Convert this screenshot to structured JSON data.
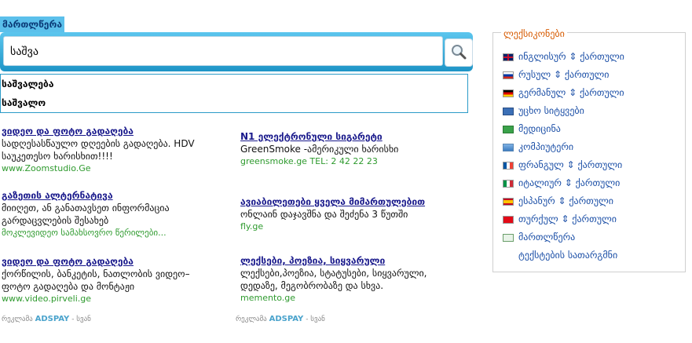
{
  "tab_label": "მართლწერა",
  "search": {
    "value": "საშვა"
  },
  "suggestions": [
    "საშვალება",
    "საშვალო"
  ],
  "ads_left": [
    {
      "title": "ვიდეო და ფოტო გადაღება",
      "desc1": "სადღესასწაულო დღეების გადაღება. HDV",
      "desc2": "საუკეთესო ხარისხით!!!!",
      "url": "www.Zoomstudio.Ge"
    },
    {
      "title": "გაზეთის ალტერნატივა",
      "desc1": "მიიღეთ, ან განათავსეთ ინფორმაცია",
      "desc2": "გარდაცვლების შესახებ",
      "url": "მოკლევიდეო სამახსოვრო წერილები..."
    },
    {
      "title": "ვიდეო და ფოტო გადაღება",
      "desc1": "ქორწილის, ბანკეტის, ნათლობის ვიდეო–",
      "desc2": "ფოტო გადაღება და მონტაჟი",
      "url": "www.video.pirveli.ge"
    }
  ],
  "ads_right": [
    {
      "title": "N1 ელექტრონული სიგარეტი",
      "desc1": "GreenSmoke -ამერიკული ხარისხი",
      "desc2": "",
      "url": "greensmoke.ge TEL: 2 42 22 23"
    },
    {
      "title": "ავიაბილეთები ყველა მიმართულებით",
      "desc1": "ონლაინ დაჯავშნა და შეძენა 3 წუთში",
      "desc2": "",
      "url": "fly.ge"
    },
    {
      "title": "ლექსები, პოეზია, სიყვარული",
      "desc1": "ლექსები,პოეზია, სტატუსები, სიყვარული,",
      "desc2": "დედაზე, მეგობრობაზე და სხვა.",
      "url": "memento.ge"
    }
  ],
  "ads_label": {
    "prefix": "რეკლამა",
    "brand": "ADSPAY",
    "suffix": "- სვან"
  },
  "dictionaries": {
    "title": "ლექსიკონები",
    "items": [
      {
        "label": "ინგლისურ ⇕ ქართული",
        "icon": "uk-flag-icon"
      },
      {
        "label": "რუსულ ⇕ ქართული",
        "icon": "russia-flag-icon"
      },
      {
        "label": "გერმანულ ⇕ ქართული",
        "icon": "germany-flag-icon"
      },
      {
        "label": "უცხო სიტყვები",
        "icon": "book-icon"
      },
      {
        "label": "მედიცინა",
        "icon": "medical-book-icon"
      },
      {
        "label": "კომპიუტერი",
        "icon": "computer-icon"
      },
      {
        "label": "ფრანგულ ⇕ ქართული",
        "icon": "france-flag-icon"
      },
      {
        "label": "იტალიურ ⇕ ქართული",
        "icon": "italy-flag-icon"
      },
      {
        "label": "ესპანურ ⇕ ქართული",
        "icon": "spain-flag-icon"
      },
      {
        "label": "თურქულ ⇕ ქართული",
        "icon": "turkey-flag-icon"
      },
      {
        "label": "მართლწერა",
        "icon": "spellcheck-icon"
      },
      {
        "label": "ტექსტების სათარგმნი",
        "icon": "translate-arrows-icon"
      }
    ]
  }
}
